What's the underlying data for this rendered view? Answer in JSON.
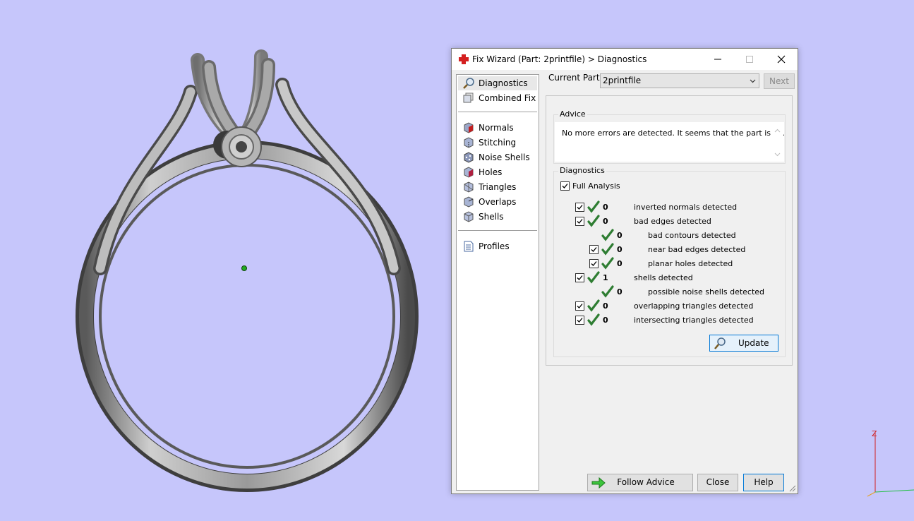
{
  "dialog": {
    "title": "Fix Wizard (Part: 2printfile) > Diagnostics",
    "controls": {
      "minimize": "minimize",
      "maximize": "maximize",
      "close": "close"
    }
  },
  "nav": {
    "items": [
      {
        "label": "Diagnostics",
        "icon": "magnifier-icon",
        "selected": true
      },
      {
        "label": "Combined Fix",
        "icon": "cube-stack-icon"
      },
      {
        "label": "Normals",
        "icon": "red-cube-icon"
      },
      {
        "label": "Stitching",
        "icon": "stitch-cube-icon"
      },
      {
        "label": "Noise Shells",
        "icon": "dotted-cube-icon"
      },
      {
        "label": "Holes",
        "icon": "hole-cube-icon"
      },
      {
        "label": "Triangles",
        "icon": "triangle-cube-icon"
      },
      {
        "label": "Overlaps",
        "icon": "overlap-cube-icon"
      },
      {
        "label": "Shells",
        "icon": "shell-cube-icon"
      },
      {
        "label": "Profiles",
        "icon": "document-icon"
      }
    ]
  },
  "current_part": {
    "label": "Current Part:",
    "value": "2printfile",
    "next": "Next"
  },
  "advice": {
    "title": "Advice",
    "text": "No more errors are detected. It seems that the part is ok."
  },
  "diagnostics": {
    "title": "Diagnostics",
    "full_analysis": "Full Analysis",
    "rows": [
      {
        "count": "0",
        "label": "inverted normals detected"
      },
      {
        "count": "0",
        "label": "bad edges detected"
      },
      {
        "count": "0",
        "label": "bad contours detected"
      },
      {
        "count": "0",
        "label": "near bad edges detected"
      },
      {
        "count": "0",
        "label": "planar holes detected"
      },
      {
        "count": "1",
        "label": "shells detected"
      },
      {
        "count": "0",
        "label": "possible noise shells detected"
      },
      {
        "count": "0",
        "label": "overlapping triangles detected"
      },
      {
        "count": "0",
        "label": "intersecting triangles detected"
      }
    ],
    "update": "Update"
  },
  "buttons": {
    "follow_advice": "Follow Advice",
    "close": "Close",
    "help": "Help"
  },
  "axis": {
    "z": "Z"
  },
  "colors": {
    "background": "#c6c6fb",
    "check_green": "#2e7d32",
    "accent_blue": "#0078d7",
    "title_icon_red": "#d42020"
  }
}
